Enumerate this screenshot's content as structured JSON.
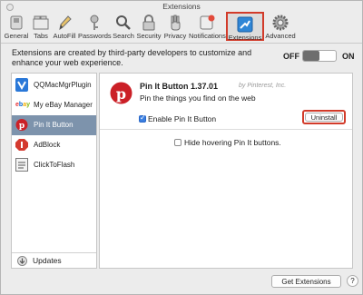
{
  "window": {
    "title": "Extensions"
  },
  "toolbar": {
    "items": [
      {
        "label": "General",
        "icon": "switch-icon"
      },
      {
        "label": "Tabs",
        "icon": "tabs-icon"
      },
      {
        "label": "AutoFill",
        "icon": "pencil-icon"
      },
      {
        "label": "Passwords",
        "icon": "key-icon"
      },
      {
        "label": "Search",
        "icon": "search-icon"
      },
      {
        "label": "Security",
        "icon": "lock-icon"
      },
      {
        "label": "Privacy",
        "icon": "hand-icon"
      },
      {
        "label": "Notifications",
        "icon": "notification-icon"
      },
      {
        "label": "Extensions",
        "icon": "puzzle-icon",
        "selected": true
      },
      {
        "label": "Advanced",
        "icon": "gear-icon"
      }
    ]
  },
  "description": "Extensions are created by third-party developers to customize and enhance your web experience.",
  "toggle": {
    "off_label": "OFF",
    "on_label": "ON",
    "state": "on"
  },
  "sidebar": {
    "items": [
      {
        "name": "QQMacMgrPlugin",
        "icon": "qq-mac-manager-icon"
      },
      {
        "name": "My eBay Manager",
        "icon": "ebay-icon"
      },
      {
        "name": "Pin It Button",
        "icon": "pinterest-icon",
        "selected": true
      },
      {
        "name": "AdBlock",
        "icon": "adblock-icon"
      },
      {
        "name": "ClickToFlash",
        "icon": "clicktoflash-icon"
      }
    ],
    "updates_label": "Updates"
  },
  "detail": {
    "title": "Pin It Button 1.37.01",
    "by": "by Pinterest, Inc.",
    "tagline": "Pin the things you find on the web",
    "enable_label": "Enable Pin It Button",
    "enabled": true,
    "uninstall_label": "Uninstall",
    "hide_label": "Hide hovering Pin It buttons.",
    "hide_checked": false
  },
  "footer": {
    "get_extensions_label": "Get Extensions",
    "help_label": "?"
  },
  "colors": {
    "selection_outline": "#d23b2a",
    "selected_row": "#7d93ac",
    "pinterest_red": "#cb2027"
  }
}
